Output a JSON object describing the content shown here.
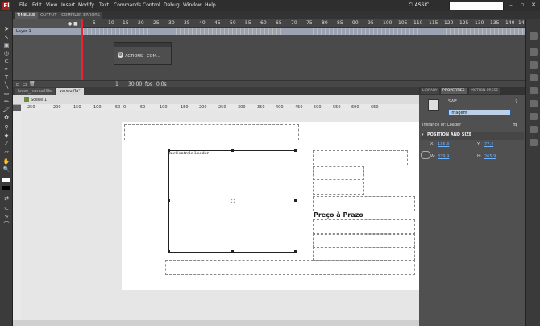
{
  "menu": {
    "logo": "Fl",
    "items": [
      "File",
      "Edit",
      "View",
      "Insert",
      "Modify",
      "Text",
      "Commands",
      "Control",
      "Debug",
      "Window",
      "Help"
    ],
    "workspace": "CLASSIC",
    "window_controls": [
      "–",
      "▫",
      "✕"
    ]
  },
  "panel_tabs": [
    "TIMELINE",
    "OUTPUT",
    "COMPILER ERRORS"
  ],
  "timeline": {
    "layer_name": "Layer 1",
    "frame_numbers": [
      "5",
      "10",
      "15",
      "20",
      "25",
      "30",
      "35",
      "40",
      "45",
      "50",
      "55",
      "60",
      "65",
      "70",
      "75",
      "80",
      "85",
      "90",
      "95",
      "100",
      "105",
      "110",
      "115",
      "120",
      "125",
      "130",
      "135",
      "140",
      "14"
    ],
    "current_frame": "1",
    "fps": "30.00",
    "fps_unit": "fps",
    "time": "0.0s"
  },
  "actions_panel": {
    "label": "ACTIONS - COM..."
  },
  "doc_tabs": [
    "loose_manualfile",
    "varejo.fla*"
  ],
  "breadcrumb": {
    "scene": "Scene 1"
  },
  "ruler_numbers": [
    "250",
    "200",
    "150",
    "100",
    "50",
    "0",
    "50",
    "100",
    "150",
    "200",
    "250",
    "300",
    "350",
    "400",
    "450",
    "500",
    "550",
    "600",
    "650"
  ],
  "stage": {
    "loader_label": "mcControle Loader",
    "price_label": "Preço à Prazo"
  },
  "properties": {
    "tabs": [
      "LIBRARY",
      "PROPERTIES",
      "MOTION PRESE"
    ],
    "active_tab": "PROPERTIES",
    "type": "SWF",
    "instance_name": "imagem",
    "instance_of_label": "Instance of:",
    "instance_of_value": "Loader",
    "section": "POSITION AND SIZE",
    "x_label": "X:",
    "x_value": "135.3",
    "y_label": "Y:",
    "y_value": "77.4",
    "w_label": "W:",
    "w_value": "339.9",
    "h_label": "H:",
    "h_value": "265.9"
  }
}
